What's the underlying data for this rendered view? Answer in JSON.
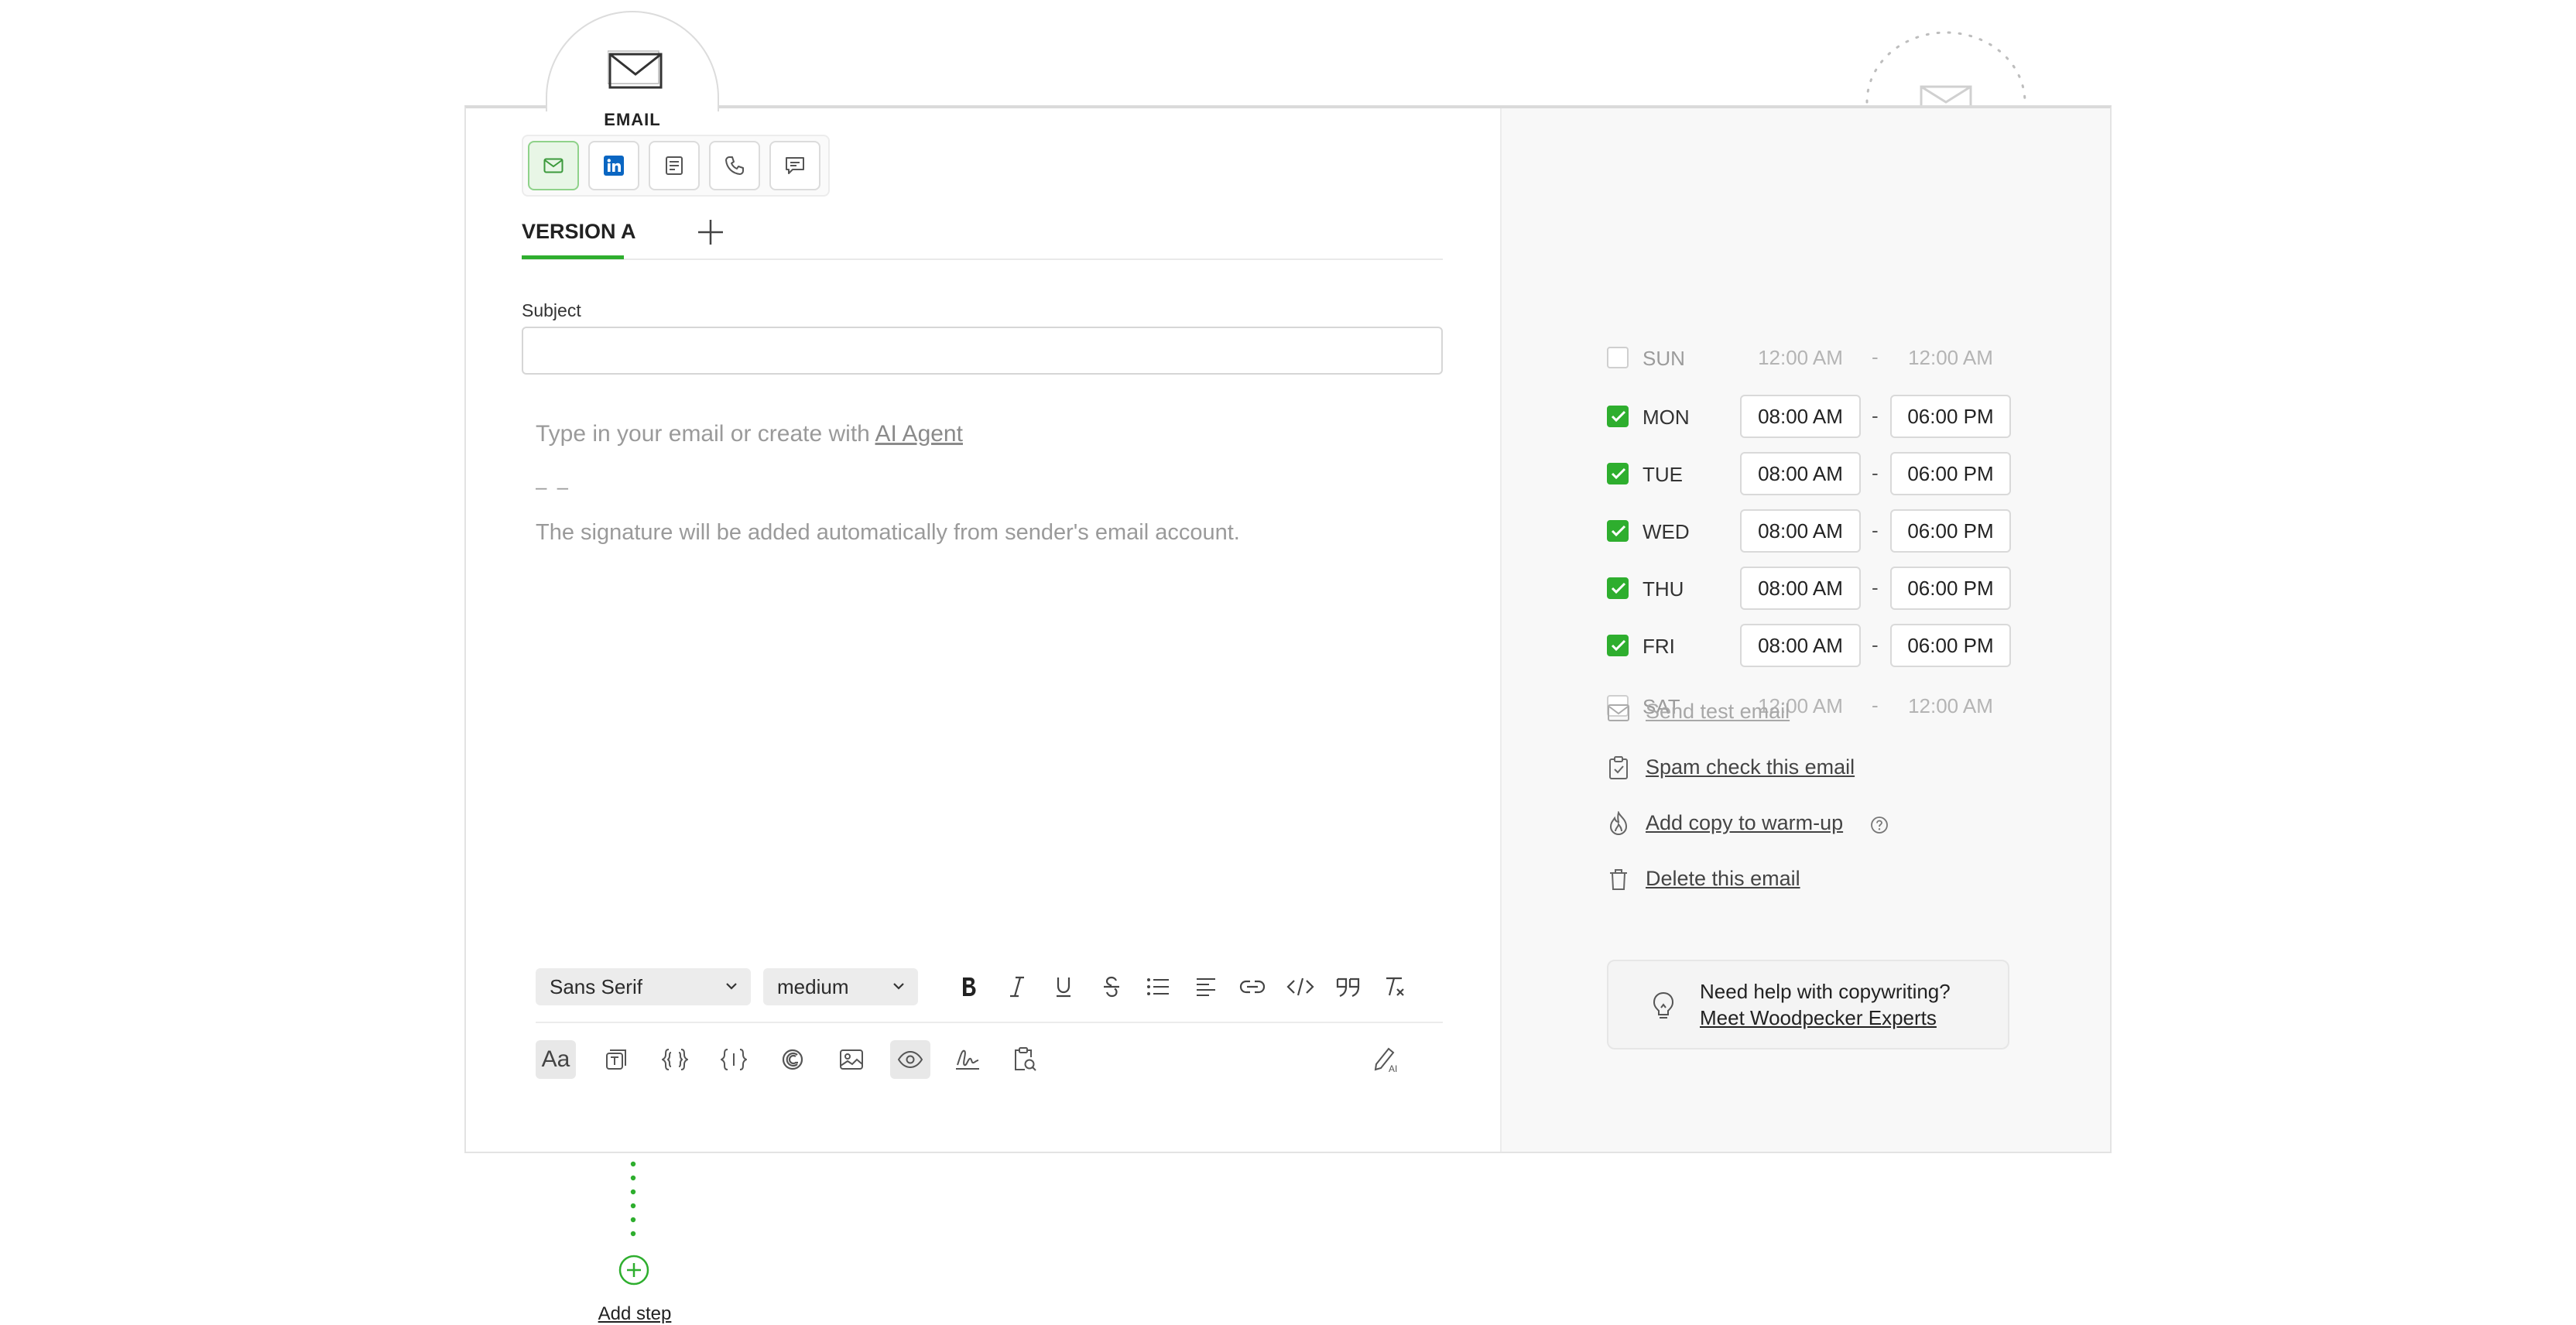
{
  "step": {
    "label": "EMAIL"
  },
  "channels": [
    {
      "name": "email-channel-icon",
      "active": true
    },
    {
      "name": "linkedin-icon",
      "active": false
    },
    {
      "name": "task-icon",
      "active": false
    },
    {
      "name": "phone-icon",
      "active": false
    },
    {
      "name": "chat-icon",
      "active": false
    }
  ],
  "version": {
    "tab_label": "VERSION A"
  },
  "subject": {
    "label": "Subject",
    "value": ""
  },
  "editor": {
    "placeholder": "Type in your email or create with ",
    "ai_link": "AI Agent",
    "signature_dash": "– –",
    "signature_note": "The signature will be added automatically from sender's email account."
  },
  "toolbar": {
    "font": "Sans Serif",
    "size": "medium",
    "case_label": "Aa",
    "icons": [
      "bold-icon",
      "italic-icon",
      "underline-icon",
      "strikethrough-icon",
      "bullet-list-icon",
      "align-left-icon",
      "link-icon",
      "code-icon",
      "quote-icon",
      "clear-format-icon"
    ],
    "icons2": [
      "text-snippet-icon",
      "variable-icon",
      "fallback-variable-icon",
      "spintax-icon",
      "image-icon",
      "preview-icon",
      "signature-icon",
      "spam-check-clipboard-icon",
      "ai-edit-icon"
    ]
  },
  "schedule": [
    {
      "day": "SUN",
      "enabled": false,
      "from": "12:00 AM",
      "to": "12:00 AM"
    },
    {
      "day": "MON",
      "enabled": true,
      "from": "08:00 AM",
      "to": "06:00 PM"
    },
    {
      "day": "TUE",
      "enabled": true,
      "from": "08:00 AM",
      "to": "06:00 PM"
    },
    {
      "day": "WED",
      "enabled": true,
      "from": "08:00 AM",
      "to": "06:00 PM"
    },
    {
      "day": "THU",
      "enabled": true,
      "from": "08:00 AM",
      "to": "06:00 PM"
    },
    {
      "day": "FRI",
      "enabled": true,
      "from": "08:00 AM",
      "to": "06:00 PM"
    },
    {
      "day": "SAT",
      "enabled": false,
      "from": "12:00 AM",
      "to": "12:00 AM"
    }
  ],
  "schedule_dash": "-",
  "actions": {
    "send_test": "Send test email",
    "spam_check": "Spam check this email",
    "warmup": "Add copy to warm-up",
    "delete": "Delete this email"
  },
  "help": {
    "question": "Need help with copywriting?",
    "link": "Meet Woodpecker Experts"
  },
  "add_step": {
    "label": "Add step"
  },
  "colors": {
    "accent": "#2eae2e",
    "panel_bg": "#f8f8f8",
    "linkedin": "#0a66c2"
  }
}
